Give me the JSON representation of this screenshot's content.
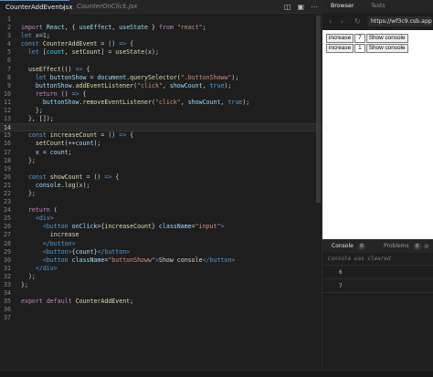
{
  "editor": {
    "tabs": [
      {
        "label": "CounterAddEvent.jsx",
        "active": true
      },
      {
        "label": "CounterOnClick.jsx",
        "active": false
      }
    ],
    "tab_close_glyph": "×",
    "actions": [
      "split-editor-icon",
      "preview-icon",
      "more-icon"
    ],
    "current_line": 11,
    "lines": [
      {
        "n": "1",
        "html": ""
      },
      {
        "n": "2",
        "html": "<span class='k'>import</span> <span class='v'>React</span>, { <span class='v'>useEffect</span>, <span class='v'>useState</span> } <span class='k'>from</span> <span class='s'>\"react\"</span>;"
      },
      {
        "n": "3",
        "html": "<span class='kb'>let</span> <span class='v'>x</span>=<span class='n'>1</span>;"
      },
      {
        "n": "4",
        "html": "<span class='kb'>const</span> <span class='f'>CounterAddEvent</span> = () <span class='kb'>=&gt;</span> {"
      },
      {
        "n": "5",
        "html": "  <span class='kb'>let</span> [<span class='c'>count</span>, <span class='f'>setCount</span>] = <span class='f'>useState</span>(<span class='v'>x</span>);"
      },
      {
        "n": "6",
        "html": ""
      },
      {
        "n": "7",
        "html": "  <span class='f'>useEffect</span>(() <span class='kb'>=&gt;</span> {"
      },
      {
        "n": "8",
        "html": "    <span class='kb'>let</span> <span class='v'>buttonShow</span> = <span class='v'>document</span>.<span class='f'>querySelector</span>(<span class='s'>\".buttonShoww\"</span>);"
      },
      {
        "n": "9",
        "html": "    <span class='v'>buttonShow</span>.<span class='f'>addEventListener</span>(<span class='s'>\"click\"</span>, <span class='v'>showCount</span>, <span class='kb'>true</span>);"
      },
      {
        "n": "10",
        "html": "    <span class='k'>return</span> () <span class='kb'>=&gt;</span> {"
      },
      {
        "n": "11",
        "html": "      <span class='v'>buttonShow</span>.<span class='f'>removeEventListener</span>(<span class='s'>\"click\"</span>, <span class='v'>showCount</span>, <span class='kb'>true</span>);"
      },
      {
        "n": "12",
        "html": "    };"
      },
      {
        "n": "13",
        "html": "  }, []);"
      },
      {
        "n": "14",
        "html": ""
      },
      {
        "n": "15",
        "html": "  <span class='kb'>const</span> <span class='f'>increaseCount</span> = () <span class='kb'>=&gt;</span> {"
      },
      {
        "n": "16",
        "html": "    <span class='f'>setCount</span>(++<span class='v'>count</span>);"
      },
      {
        "n": "17",
        "html": "    <span class='v'>x</span> = <span class='v'>count</span>;"
      },
      {
        "n": "18",
        "html": "  };"
      },
      {
        "n": "19",
        "html": ""
      },
      {
        "n": "20",
        "html": "  <span class='kb'>const</span> <span class='f'>showCount</span> = () <span class='kb'>=&gt;</span> {"
      },
      {
        "n": "21",
        "html": "    <span class='v'>console</span>.<span class='f'>log</span>(<span class='v'>x</span>);"
      },
      {
        "n": "22",
        "html": "  };"
      },
      {
        "n": "23",
        "html": ""
      },
      {
        "n": "24",
        "html": "  <span class='k'>return</span> ("
      },
      {
        "n": "25",
        "html": "    <span class='t'>&lt;div&gt;</span>"
      },
      {
        "n": "26",
        "html": "      <span class='t'>&lt;button</span> <span class='a'>onClick</span>={<span class='f'>increaseCount</span>} <span class='a'>className</span>=<span class='s'>\"input\"</span><span class='t'>&gt;</span>"
      },
      {
        "n": "27",
        "html": "        increase"
      },
      {
        "n": "28",
        "html": "      <span class='t'>&lt;/button&gt;</span>"
      },
      {
        "n": "29",
        "html": "      <span class='t'>&lt;button&gt;</span>{<span class='v'>count</span>}<span class='t'>&lt;/button&gt;</span>"
      },
      {
        "n": "30",
        "html": "      <span class='t'>&lt;button</span> <span class='a'>className</span>=<span class='s'>\"buttonShoww\"</span><span class='t'>&gt;</span>Show console<span class='t'>&lt;/button&gt;</span>"
      },
      {
        "n": "31",
        "html": "    <span class='t'>&lt;/div&gt;</span>"
      },
      {
        "n": "32",
        "html": "  );"
      },
      {
        "n": "33",
        "html": "};"
      },
      {
        "n": "34",
        "html": ""
      },
      {
        "n": "35",
        "html": "<span class='k'>export</span> <span class='k'>default</span> <span class='f'>CounterAddEvent</span>;"
      },
      {
        "n": "36",
        "html": ""
      },
      {
        "n": "37",
        "html": ""
      }
    ]
  },
  "preview": {
    "tabs": [
      {
        "label": "Browser",
        "active": true
      },
      {
        "label": "Tests",
        "active": false
      }
    ],
    "nav": {
      "back": "‹",
      "forward": "›",
      "refresh": "↻"
    },
    "url": "https://wf3c9.csb.app/",
    "rows": [
      {
        "increase": "increase",
        "count": "7",
        "show": "Show console"
      },
      {
        "increase": "increase",
        "count": "1",
        "show": "Show console"
      }
    ]
  },
  "console": {
    "tabs": [
      {
        "label": "Console",
        "badge": "0"
      },
      {
        "label": "Problems",
        "badge": "0"
      }
    ],
    "clear_glyph": "⊘",
    "cleared_text": "Console was cleared",
    "outputs": [
      "6",
      "7"
    ]
  }
}
